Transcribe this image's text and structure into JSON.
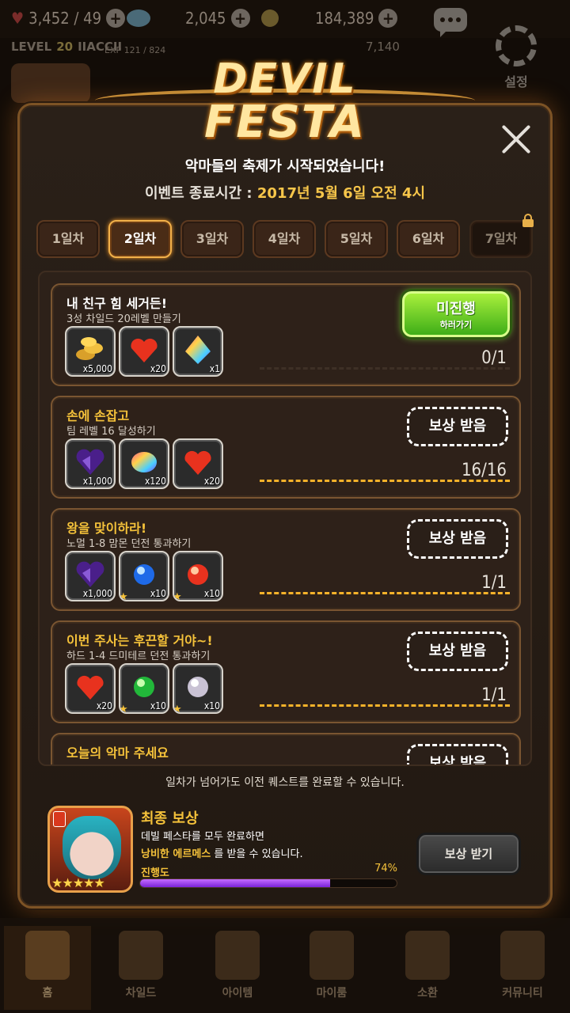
{
  "topbar": {
    "hearts": "3,452 / 49",
    "gems": "2,045",
    "gold": "184,389",
    "level_label": "LEVEL",
    "level_value": "20",
    "player_name": "IIACCII",
    "exp": "EXP 121 / 824",
    "gold_small": "7,140",
    "settings_label": "설정"
  },
  "event": {
    "logo_line1": "DEVIL",
    "logo_line2": "FESTA",
    "headline": "악마들의 축제가 시작되었습니다!",
    "end_label": "이벤트 종료시간 : ",
    "end_value": "2017년 5월 6일 오전 4시"
  },
  "tabs": [
    "1일차",
    "2일차",
    "3일차",
    "4일차",
    "5일차",
    "6일차",
    "7일차"
  ],
  "active_tab": "2일차",
  "quests": [
    {
      "title": "내 친구 힘 세거든!",
      "title_color": "#ffffff",
      "desc": "3성 차일드 20레벨 만들기",
      "items": [
        {
          "icon": "gold-coins-icon",
          "qty": "x5,000"
        },
        {
          "icon": "heart-icon",
          "qty": "x20"
        },
        {
          "icon": "rainbow-crystal-icon",
          "qty": "x1"
        }
      ],
      "button": "미진행",
      "button_sub": "하러가기",
      "progress": "0/1",
      "progress_fraction": 0
    },
    {
      "title": "손에 손잡고",
      "title_color": "#f5c23a",
      "desc": "팀 레벨 16 달성하기",
      "items": [
        {
          "icon": "purple-gem-icon",
          "qty": "x1,000"
        },
        {
          "icon": "rainbow-stone-icon",
          "qty": "x120"
        },
        {
          "icon": "heart-icon",
          "qty": "x20"
        }
      ],
      "button": "보상 받음",
      "progress": "16/16",
      "progress_fraction": 1
    },
    {
      "title": "왕을 맞이하라!",
      "title_color": "#f5c23a",
      "desc": "노멀 1-8 맘몬 던전 통과하기",
      "items": [
        {
          "icon": "purple-gem-icon",
          "qty": "x1,000"
        },
        {
          "icon": "blue-orb-icon",
          "qty": "x10"
        },
        {
          "icon": "red-orb-icon",
          "qty": "x10"
        }
      ],
      "button": "보상 받음",
      "progress": "1/1",
      "progress_fraction": 1
    },
    {
      "title": "이번 주사는 후끈할 거야~!",
      "title_color": "#f5c23a",
      "desc": "하드 1-4 드미테르 던전 통과하기",
      "items": [
        {
          "icon": "heart-icon",
          "qty": "x20"
        },
        {
          "icon": "green-orb-icon",
          "qty": "x10"
        },
        {
          "icon": "white-orb-icon",
          "qty": "x10"
        }
      ],
      "button": "보상 받음",
      "progress": "1/1",
      "progress_fraction": 1
    },
    {
      "title": "오늘의 악마 주세요",
      "title_color": "#f5c23a",
      "desc": "",
      "items": [],
      "button": "보상 받음",
      "progress": "",
      "progress_fraction": 1
    }
  ],
  "notice": "일차가 넘어가도 이전 퀘스트를 완료할 수 있습니다.",
  "final_reward": {
    "title": "최종 보상",
    "line1": "데빌 페스타를 모두 완료하면",
    "reward_name": "낭비한 에르메스",
    "line2_suffix": " 를 받을 수 있습니다.",
    "progress_label": "진행도",
    "progress_text": "74%",
    "progress_value": 0.74,
    "stars": "★★★★★",
    "button": "보상 받기"
  },
  "nav": [
    "홈",
    "차일드",
    "아이템",
    "마이룸",
    "소환",
    "커뮤니티"
  ],
  "colors": {
    "accent": "#f5c23a",
    "panel_border": "#7d5325",
    "active_green": "#5fcf22"
  }
}
